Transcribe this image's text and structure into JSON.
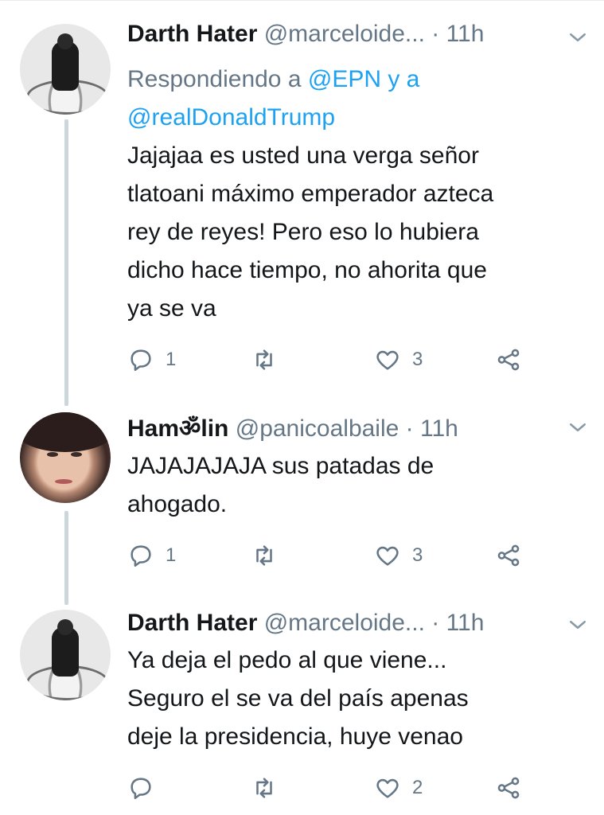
{
  "tweets": [
    {
      "name": "Darth Hater",
      "handle": "@marceloide...",
      "time": "· 11h",
      "reply_prefix": "Respondiendo a ",
      "reply_mention_1": "@EPN",
      "reply_joiner": " y a",
      "reply_mention_2": "@realDonaldTrump",
      "lines": [
        "Jajajaa es usted una verga señor",
        "tlatoani máximo emperador azteca",
        "rey de reyes! Pero eso lo hubiera",
        "dicho hace tiempo, no ahorita que",
        "ya se va"
      ],
      "replies": "1",
      "retweets": "",
      "likes": "3"
    },
    {
      "name": "Hamॐlin",
      "handle": "@panicoalbaile",
      "time": "· 11h",
      "lines": [
        "JAJAJAJAJA sus patadas de",
        "ahogado."
      ],
      "replies": "1",
      "retweets": "",
      "likes": "3"
    },
    {
      "name": "Darth Hater",
      "handle": "@marceloide...",
      "time": "· 11h",
      "lines": [
        "Ya deja el pedo al que viene...",
        "Seguro el se va del país apenas",
        "deje la presidencia, huye venao"
      ],
      "replies": "",
      "retweets": "",
      "likes": "2"
    }
  ],
  "icons": {
    "reply": "reply-icon",
    "retweet": "retweet-icon",
    "like": "heart-icon",
    "share": "share-icon",
    "caret": "chevron-down-icon"
  },
  "colors": {
    "link": "#1da1f2",
    "secondary": "#657786",
    "thread_line": "#ccd6dd"
  }
}
